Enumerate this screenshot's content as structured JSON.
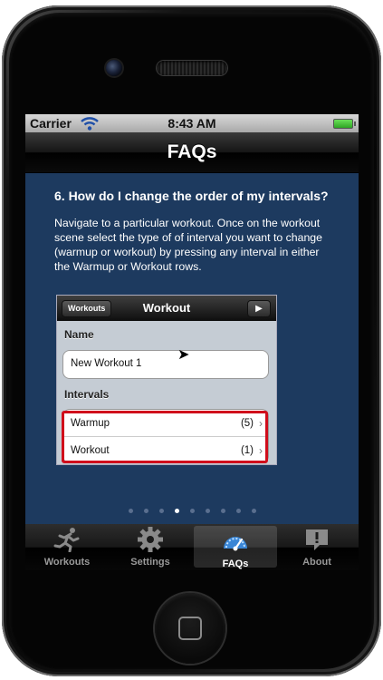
{
  "status_bar": {
    "carrier": "Carrier",
    "time": "8:43 AM"
  },
  "nav": {
    "title": "FAQs"
  },
  "faq": {
    "question": "6. How do I change the order of my intervals?",
    "answer": "Navigate to a particular workout.  Once on the workout scene select the type of of interval you want to change (warmup or workout) by pressing any interval in either the Warmup or Workout rows."
  },
  "screenshot": {
    "back_label": "Workouts",
    "title": "Workout",
    "name_header": "Name",
    "name_value": "New Workout 1",
    "intervals_header": "Intervals",
    "rows": [
      {
        "label": "Warmup",
        "count": "(5)"
      },
      {
        "label": "Workout",
        "count": "(1)"
      }
    ]
  },
  "pager": {
    "total": 9,
    "current_index": 3
  },
  "tabs": [
    {
      "label": "Workouts",
      "icon": "runner-icon",
      "selected": false
    },
    {
      "label": "Settings",
      "icon": "gear-icon",
      "selected": false
    },
    {
      "label": "FAQs",
      "icon": "speedometer-icon",
      "selected": true
    },
    {
      "label": "About",
      "icon": "speech-bubble-exclamation-icon",
      "selected": false
    }
  ],
  "colors": {
    "content_background": "#1d3a5f",
    "highlight": "#d00d1b",
    "battery": "#2ea524"
  }
}
